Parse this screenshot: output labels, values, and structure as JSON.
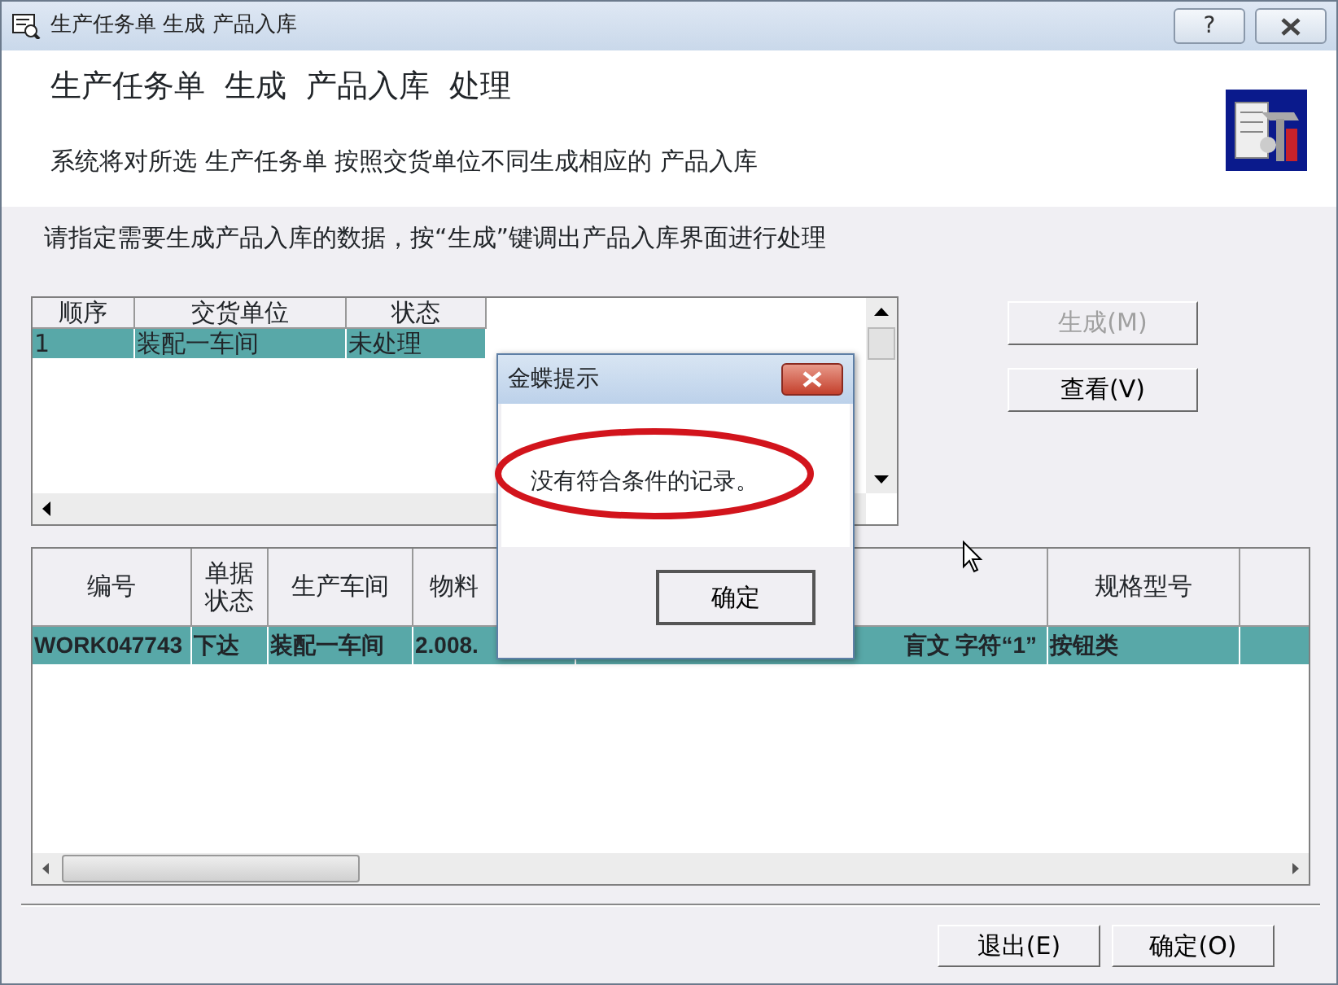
{
  "window": {
    "title": "生产任务单 生成 产品入库",
    "help": "?"
  },
  "header": {
    "title": "生产任务单  生成  产品入库  处理",
    "description": "系统将对所选 生产任务单 按照交货单位不同生成相应的 产品入库"
  },
  "instruction": "请指定需要生成产品入库的数据，按“生成”键调出产品入库界面进行处理",
  "units_grid": {
    "columns": [
      "顺序",
      "交货单位",
      "状态"
    ],
    "rows": [
      {
        "cells": [
          "1",
          "装配一车间",
          "未处理"
        ],
        "selected": true
      }
    ]
  },
  "side_buttons": [
    {
      "label": "生成(M)",
      "disabled": true
    },
    {
      "label": "查看(V)",
      "disabled": false
    }
  ],
  "orders_grid": {
    "columns": [
      {
        "label": "编号"
      },
      {
        "label": "单据状态"
      },
      {
        "label": "生产车间"
      },
      {
        "label": "物料"
      },
      {
        "kind": "blank"
      },
      {
        "label": "规格型号"
      },
      {
        "kind": "blank"
      }
    ],
    "rows": [
      {
        "cells": [
          "WORK047743",
          "下达",
          "装配一车间",
          "2.008.",
          "盲文 字符“1”",
          "按钮类"
        ],
        "selected": true
      }
    ]
  },
  "dialog": {
    "title": "金蝶提示",
    "message": "没有符合条件的记录。",
    "button": "确定"
  },
  "footer_buttons": [
    "退出(E)",
    "确定(O)"
  ]
}
